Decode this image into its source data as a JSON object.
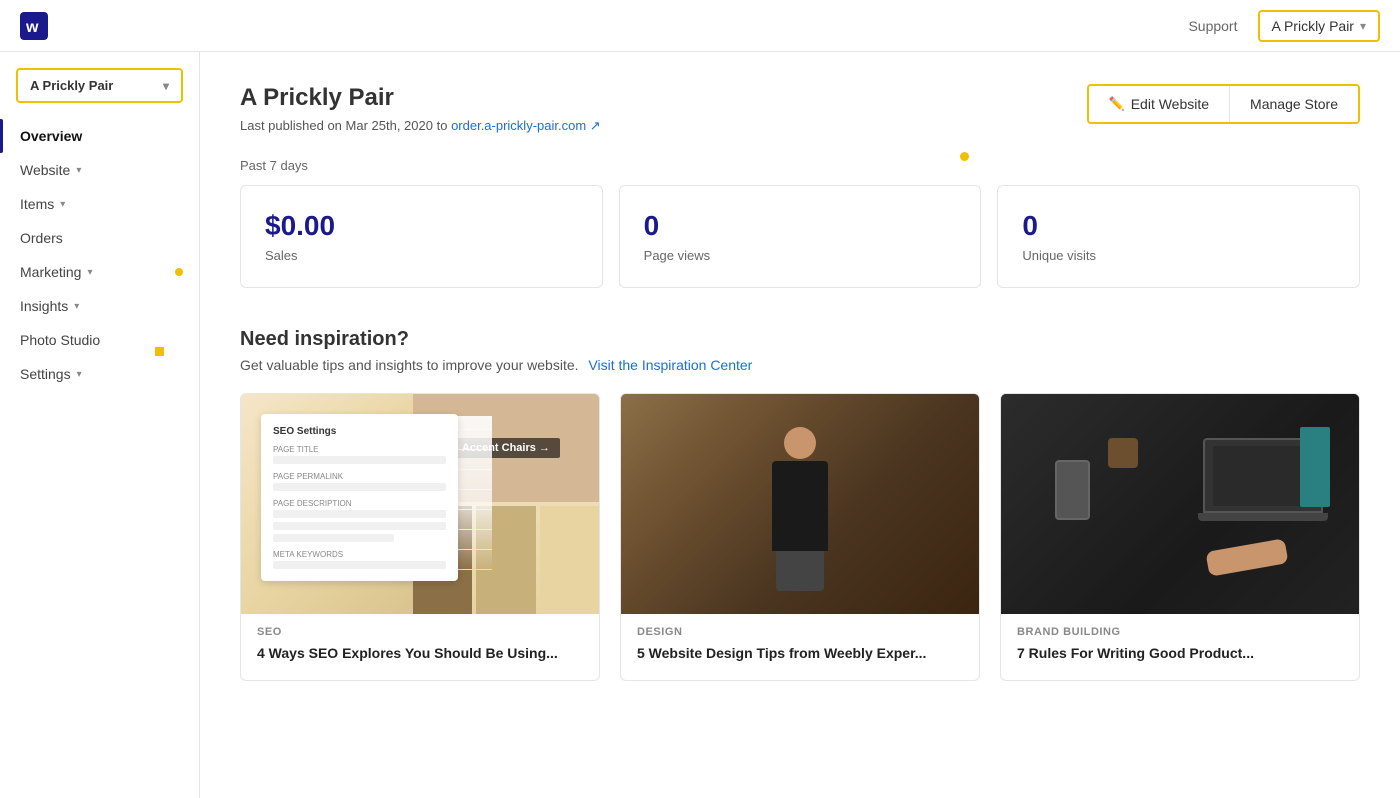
{
  "topnav": {
    "support_label": "Support",
    "store_name": "A Prickly Pair",
    "chevron": "▾"
  },
  "sidebar": {
    "store_name": "A Prickly Pair",
    "chevron": "▾",
    "items": [
      {
        "id": "overview",
        "label": "Overview",
        "active": true,
        "has_chevron": false,
        "has_dot": false
      },
      {
        "id": "website",
        "label": "Website",
        "active": false,
        "has_chevron": true,
        "has_dot": false
      },
      {
        "id": "items",
        "label": "Items",
        "active": false,
        "has_chevron": true,
        "has_dot": false
      },
      {
        "id": "orders",
        "label": "Orders",
        "active": false,
        "has_chevron": false,
        "has_dot": false
      },
      {
        "id": "marketing",
        "label": "Marketing",
        "active": false,
        "has_chevron": true,
        "has_dot": true
      },
      {
        "id": "insights",
        "label": "Insights",
        "active": false,
        "has_chevron": true,
        "has_dot": false
      },
      {
        "id": "photo-studio",
        "label": "Photo Studio",
        "active": false,
        "has_chevron": false,
        "has_dot": false
      },
      {
        "id": "settings",
        "label": "Settings",
        "active": false,
        "has_chevron": true,
        "has_dot": false
      }
    ]
  },
  "main": {
    "page_title": "A Prickly Pair",
    "last_published": "Last published on Mar 25th, 2020 to",
    "site_url": "order.a-prickly-pair.com",
    "edit_website_label": "Edit Website",
    "manage_store_label": "Manage Store",
    "stats_period": "Past 7 days",
    "stats": [
      {
        "value": "$0.00",
        "label": "Sales"
      },
      {
        "value": "0",
        "label": "Page views"
      },
      {
        "value": "0",
        "label": "Unique visits"
      }
    ],
    "inspiration": {
      "title": "Need inspiration?",
      "subtitle": "Get valuable tips and insights to improve your website.",
      "cta_label": "Visit the Inspiration Center"
    },
    "articles": [
      {
        "category": "SEO",
        "title": "4 Ways SEO Explores You Should Be Using..."
      },
      {
        "category": "DESIGN",
        "title": "5 Website Design Tips from Weebly Exper..."
      },
      {
        "category": "BRAND BUILDING",
        "title": "7 Rules For Writing Good Product..."
      }
    ]
  }
}
